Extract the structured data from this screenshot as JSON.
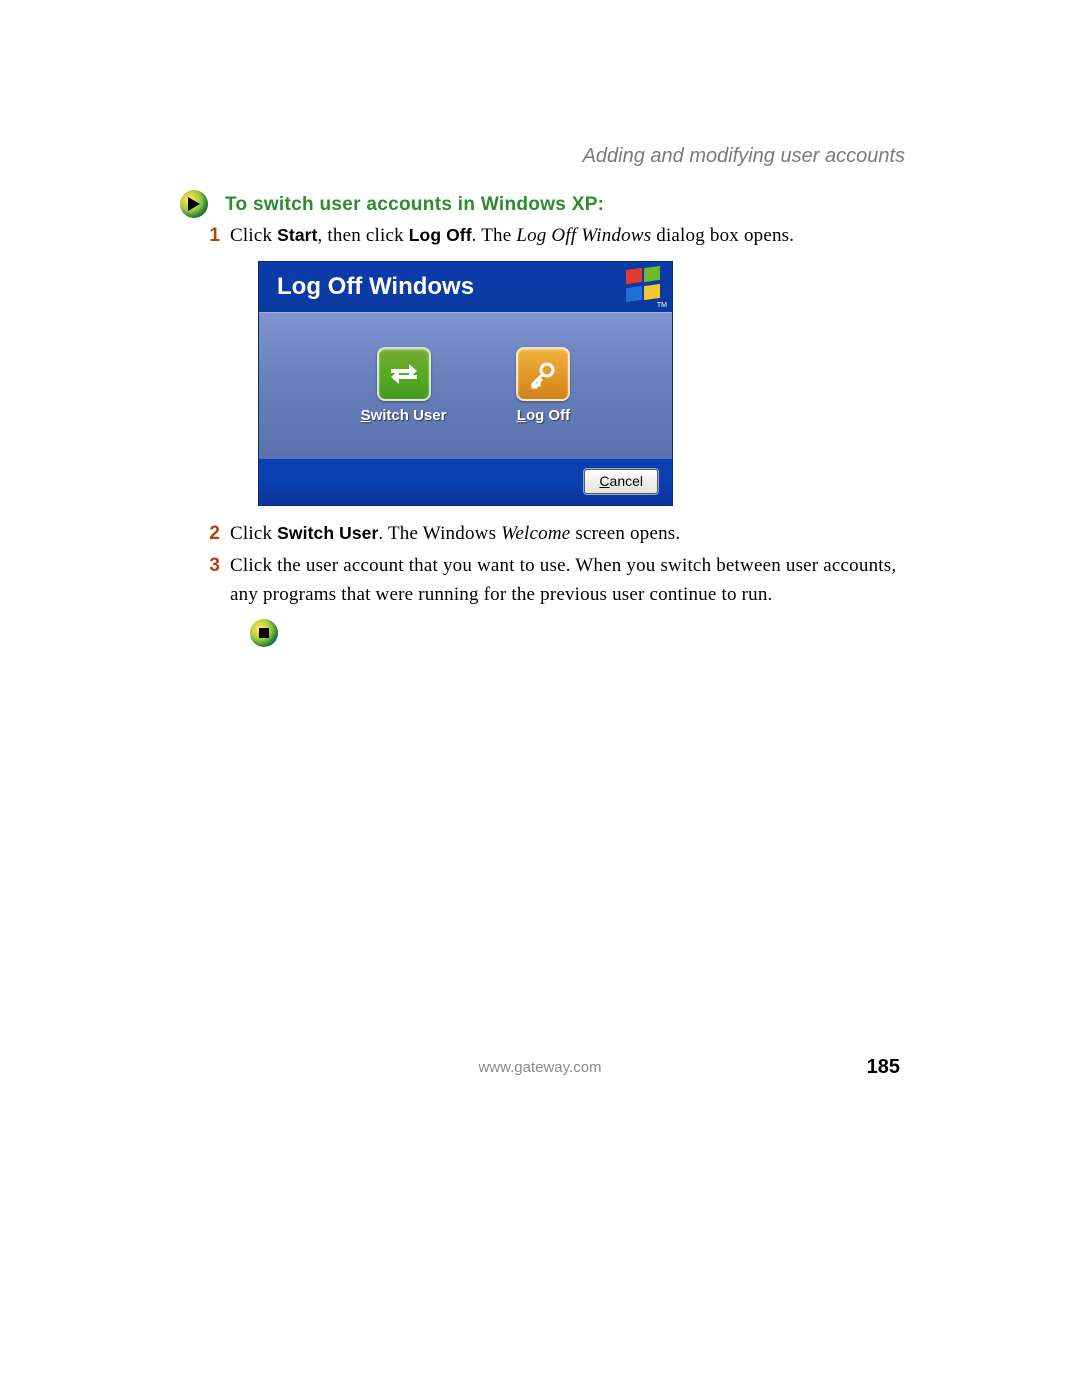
{
  "header": {
    "section_title": "Adding and modifying user accounts"
  },
  "heading": "To switch user accounts in Windows XP:",
  "steps": {
    "s1": {
      "num": "1",
      "p1": "Click ",
      "b1": "Start",
      "p2": ", then click ",
      "b2": "Log Off",
      "p3": ". The ",
      "i1": "Log Off Windows",
      "p4": " dialog box opens."
    },
    "s2": {
      "num": "2",
      "p1": "Click ",
      "b1": "Switch User",
      "p2": ". The Windows ",
      "i1": "Welcome",
      "p3": " screen opens."
    },
    "s3": {
      "num": "3",
      "text": "Click the user account that you want to use. When you switch between user accounts, any programs that were running for the previous user continue to run."
    }
  },
  "dialog": {
    "title": "Log Off Windows",
    "switch_user": {
      "underline": "S",
      "rest": "witch User"
    },
    "logoff": {
      "underline": "L",
      "rest": "og Off"
    },
    "cancel": {
      "underline": "C",
      "rest": "ancel"
    },
    "logo_tm": "TM"
  },
  "footer": {
    "url": "www.gateway.com",
    "page": "185"
  },
  "icons": {
    "play": "play-icon",
    "stop": "stop-icon",
    "switch": "switch-user-icon",
    "key": "key-icon",
    "xp": "windows-xp-logo-icon"
  }
}
